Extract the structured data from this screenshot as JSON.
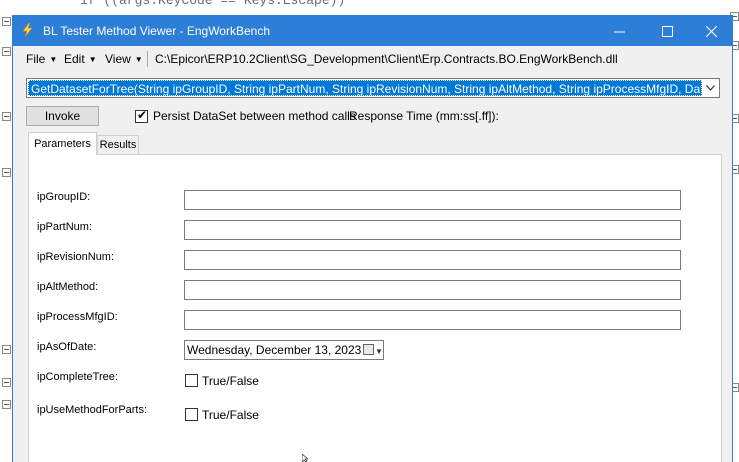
{
  "editor": {
    "code_line": "if ((args.KeyCode == Keys.Escape))"
  },
  "window": {
    "title": "BL Tester Method Viewer - EngWorkBench",
    "controls": {
      "minimize": "—",
      "maximize": "☐",
      "close": "✕"
    }
  },
  "menu": {
    "file": "File",
    "edit": "Edit",
    "view": "View",
    "dll_path": "C:\\Epicor\\ERP10.2Client\\SG_Development\\Client\\Erp.Contracts.BO.EngWorkBench.dll"
  },
  "method_select": {
    "value": "GetDatasetForTree(String ipGroupID, String ipPartNum, String ipRevisionNum, String ipAltMethod, String ipProcessMfgID, DateTime? ipAsOfDate, Boolean ipCompleteTree, Boolean ipUseMethodForParts)"
  },
  "toolbar": {
    "invoke_label": "Invoke",
    "persist_label": "Persist DataSet between method calls",
    "persist_checked": true,
    "response_time_label": "Response Time (mm:ss[.ff]):"
  },
  "tabs": [
    {
      "label": "Parameters",
      "active": true
    },
    {
      "label": "Results",
      "active": false
    }
  ],
  "params": {
    "group_id": {
      "label": "ipGroupID:",
      "value": ""
    },
    "part_num": {
      "label": "ipPartNum:",
      "value": ""
    },
    "revision_num": {
      "label": "ipRevisionNum:",
      "value": ""
    },
    "alt_method": {
      "label": "ipAltMethod:",
      "value": ""
    },
    "process_mfg_id": {
      "label": "ipProcessMfgID:",
      "value": ""
    },
    "as_of_date": {
      "label": "ipAsOfDate:",
      "value": "Wednesday, December 13, 2023"
    },
    "complete_tree": {
      "label": "ipCompleteTree:",
      "option": "True/False",
      "checked": false
    },
    "use_method_for_parts": {
      "label": "ipUseMethodForParts:",
      "option": "True/False",
      "checked": false
    }
  },
  "colors": {
    "titlebar": "#2c7ed6",
    "selection": "#0078d7",
    "window_bg": "#f0f0f0"
  },
  "icons": [
    "lightning-app-icon",
    "calendar-icon",
    "chevron-down-icon",
    "checkmark-icon"
  ]
}
